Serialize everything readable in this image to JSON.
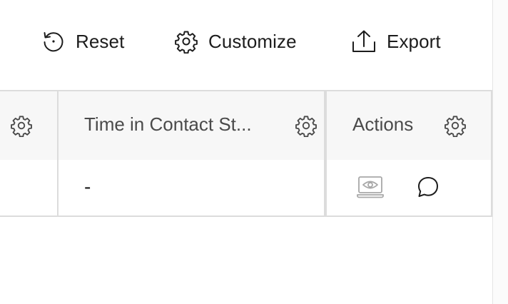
{
  "toolbar": {
    "reset_label": "Reset",
    "customize_label": "Customize",
    "export_label": "Export"
  },
  "table": {
    "columns": [
      {
        "label": "",
        "icon": "gear-icon"
      },
      {
        "label": "Time in Contact St...",
        "icon": "gear-icon"
      },
      {
        "label": "Actions",
        "icon": "gear-icon"
      }
    ],
    "rows": [
      {
        "time_in_contact_state": "-",
        "actions": [
          "view-screen-icon",
          "chat-icon"
        ]
      }
    ]
  },
  "colors": {
    "text": "#1c1c1c",
    "header_text": "#4a4a4a",
    "header_bg": "#f7f7f7",
    "border": "#dcdcdc",
    "disabled_icon": "#a8a8a8"
  }
}
